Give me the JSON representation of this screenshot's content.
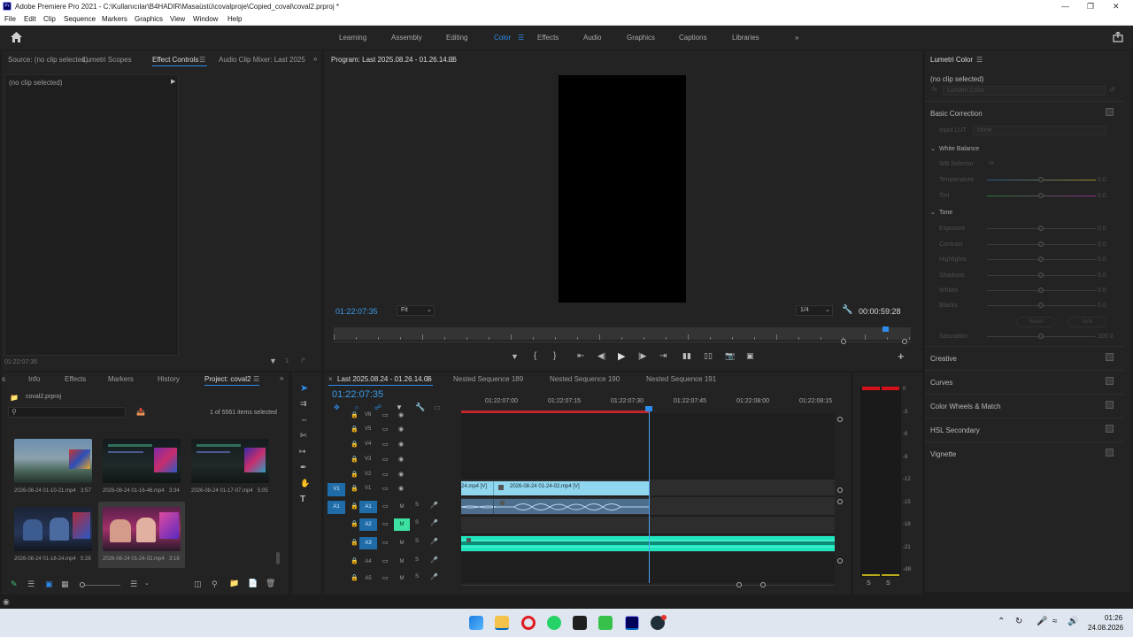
{
  "window": {
    "title": "Adobe Premiere Pro 2021 - C:\\Kullanıcılar\\B4HADIR\\Masaüstü\\covalproje\\Copied_coval\\coval2.prproj *",
    "app_icon": "Pr"
  },
  "menu": [
    "File",
    "Edit",
    "Clip",
    "Sequence",
    "Markers",
    "Graphics",
    "View",
    "Window",
    "Help"
  ],
  "workspaces": {
    "items": [
      "Learning",
      "Assembly",
      "Editing",
      "Color",
      "Effects",
      "Audio",
      "Graphics",
      "Captions",
      "Libraries"
    ],
    "active": "Color",
    "more": "»"
  },
  "source_panel": {
    "tabs": [
      "Source: (no clip selected)",
      "Lumetri Scopes",
      "Effect Controls",
      "Audio Clip Mixer: Last 2025"
    ],
    "active_tab": "Effect Controls",
    "no_clip": "(no clip selected)",
    "timecode": "01:22:07:35"
  },
  "program_monitor": {
    "title": "Program: Last 2025.08.24 - 01.26.14.06",
    "timecode": "01:22:07:35",
    "fit": "Fit",
    "resolution": "1/4",
    "duration": "00:00:59:28",
    "playhead_fraction": 0.955
  },
  "lumetri": {
    "title": "Lumetri Color",
    "no_clip": "(no clip selected)",
    "fx_label": "fx",
    "fx_name": "Lumetri Color",
    "basic_correction": "Basic Correction",
    "input_lut_label": "Input LUT",
    "input_lut_value": "None",
    "white_balance": "White Balance",
    "wb_selector": "WB Selector",
    "tone": "Tone",
    "sliders": [
      {
        "label": "Temperature",
        "value": "0.0"
      },
      {
        "label": "Tint",
        "value": "0.0"
      },
      {
        "label": "Exposure",
        "value": "0.0"
      },
      {
        "label": "Contrast",
        "value": "0.0"
      },
      {
        "label": "Highlights",
        "value": "0.0"
      },
      {
        "label": "Shadows",
        "value": "0.0"
      },
      {
        "label": "Whites",
        "value": "0.0"
      },
      {
        "label": "Blacks",
        "value": "0.0"
      }
    ],
    "reset": "Reset",
    "auto": "Auto",
    "saturation_label": "Saturation",
    "saturation_value": "100.0",
    "sections": [
      "Creative",
      "Curves",
      "Color Wheels & Match",
      "HSL Secondary",
      "Vignette"
    ]
  },
  "project_panel": {
    "tabs": [
      "Info",
      "Effects",
      "Markers",
      "History",
      "Project: coval2"
    ],
    "active_tab": "Project: coval2",
    "project_file": "coval2.prproj",
    "items_selected": "1 of 5561 items selected",
    "thumbnails": [
      {
        "name": "2026-08-24 01-10-21.mp4",
        "duration": "3:57"
      },
      {
        "name": "2026-08-24 01-16-46.mp4",
        "duration": "3:34"
      },
      {
        "name": "2026-08-24 01-17-07.mp4",
        "duration": "5:05"
      },
      {
        "name": "2026-08-24 01-18-24.mp4",
        "duration": "5:26"
      },
      {
        "name": "2026-08-24 01-24-02.mp4",
        "duration": "3:18"
      }
    ]
  },
  "timeline": {
    "tabs": [
      "Last 2025.08.24 - 01.26.14.06",
      "Nested Sequence 189",
      "Nested Sequence 190",
      "Nested Sequence 191"
    ],
    "active_tab": "Last 2025.08.24 - 01.26.14.06",
    "timecode": "01:22:07:35",
    "ruler": [
      "01:22:07:00",
      "01:22:07:15",
      "01:22:07:30",
      "01:22:07:45",
      "01:22:08:00",
      "01:22:08:15"
    ],
    "video_tracks": [
      "V6",
      "V5",
      "V4",
      "V3",
      "V2",
      "V1"
    ],
    "audio_tracks": [
      "A1",
      "A2",
      "A3",
      "A4",
      "A5"
    ],
    "source_patch_v": "V1",
    "source_patch_a": "A1",
    "mute_label": "M",
    "solo_label": "S",
    "clip_v1_a": "24.mp4 [V]",
    "clip_v1_b": "2026-08-24 01-24-02.mp4 [V]"
  },
  "audio_meter": {
    "ticks": [
      "0",
      "-3",
      "-6",
      "-9",
      "-12",
      "-15",
      "-18",
      "-21",
      "-dB"
    ],
    "solo": "S"
  },
  "status": {
    "clock_time": "01:26",
    "clock_date": "24.08.2026"
  },
  "colors": {
    "accent": "#2d8ceb",
    "video_clip": "#8fd6ee",
    "audio_clip": "#1ee7c0",
    "timecode": "#3c9ae8"
  }
}
